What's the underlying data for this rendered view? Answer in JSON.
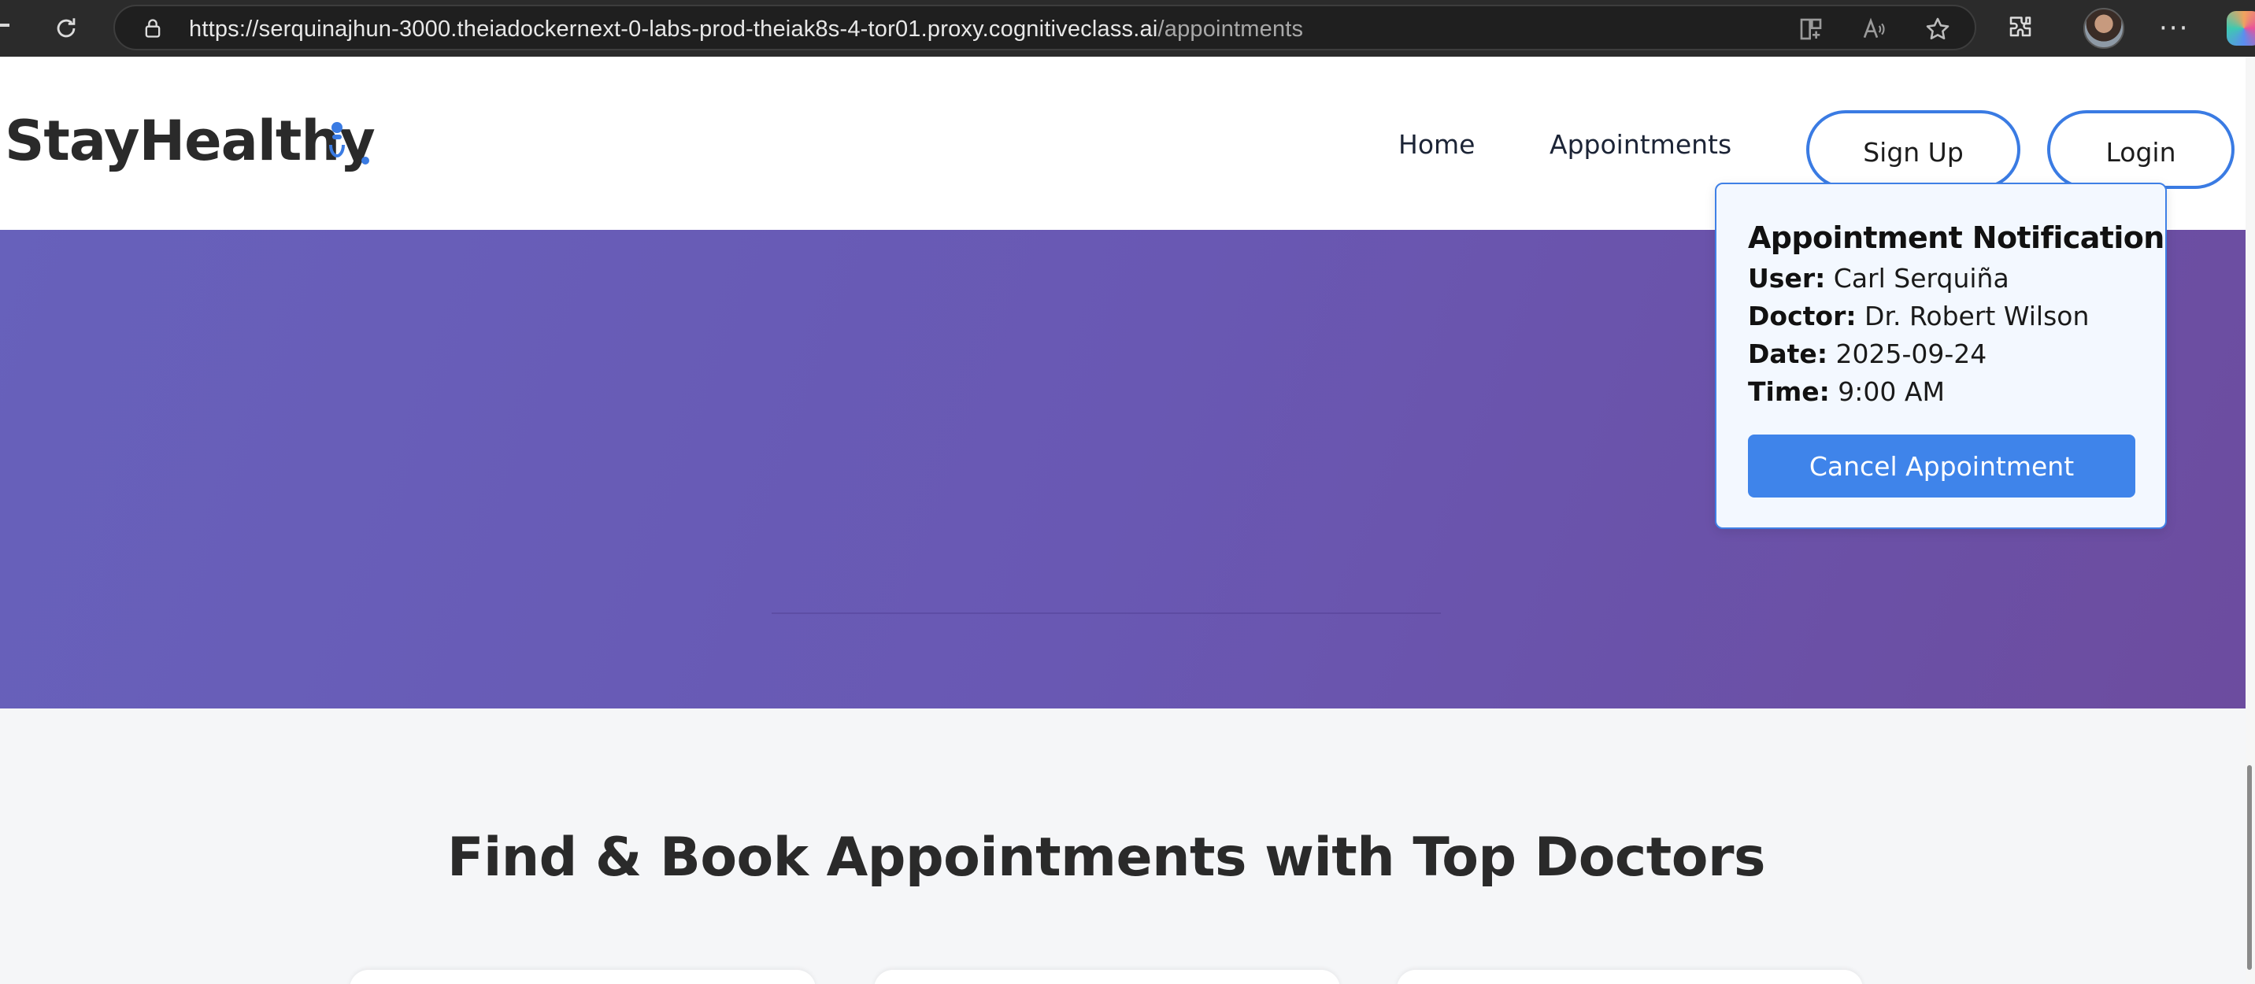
{
  "browser": {
    "url_host": "https://serquinajhun-3000.theiadockernext-0-labs-prod-theiak8s-4-tor01.proxy.cognitiveclass.ai",
    "url_path": "/appointments",
    "icons": [
      "refresh-icon",
      "lock-icon",
      "split-screen-icon",
      "read-aloud-icon",
      "favorite-star-icon",
      "extensions-icon",
      "profile-avatar",
      "more-icon",
      "copilot-icon"
    ]
  },
  "header": {
    "logo": "StayHealthy",
    "nav": {
      "home": "Home",
      "appointments": "Appointments"
    },
    "sign_up": "Sign Up",
    "login": "Login"
  },
  "notification": {
    "title": "Appointment Notification",
    "user_label": "User:",
    "user_value": "Carl Serquiña",
    "doctor_label": "Doctor:",
    "doctor_value": "Dr. Robert Wilson",
    "date_label": "Date:",
    "date_value": "2025-09-24",
    "time_label": "Time:",
    "time_value": "9:00 AM",
    "cancel_button": "Cancel Appointment"
  },
  "main": {
    "section_title": "Find & Book Appointments with Top Doctors"
  },
  "colors": {
    "accent": "#3f84ea",
    "hero_start": "#6761bb",
    "hero_end": "#6c4c9f",
    "section_bg": "#f5f6f8"
  }
}
